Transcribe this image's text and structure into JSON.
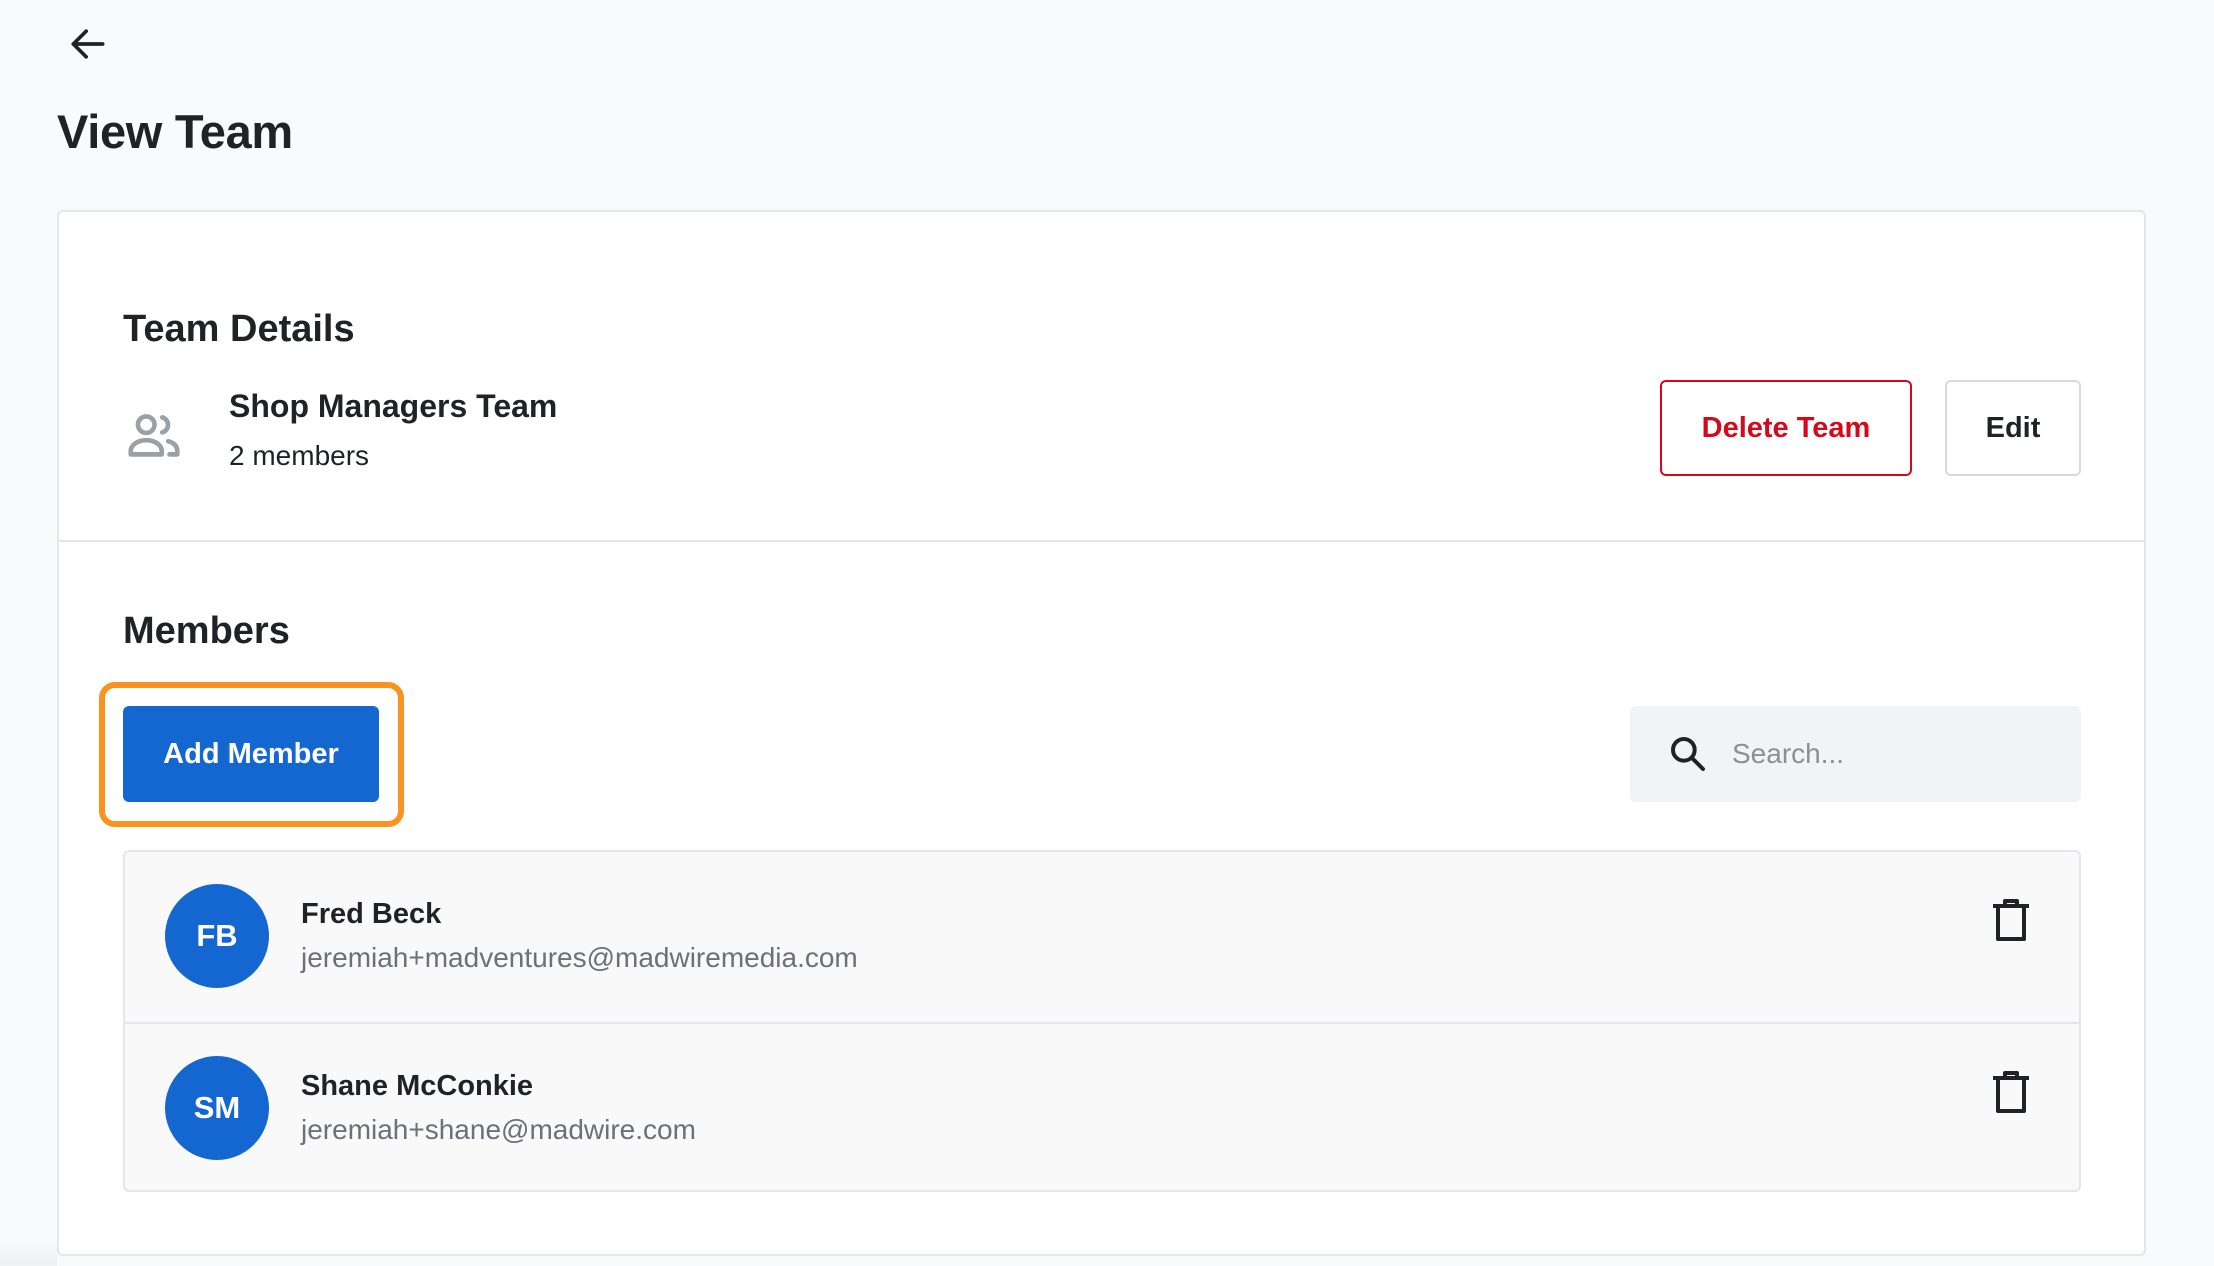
{
  "header": {
    "back_icon": "arrow-left-icon",
    "title": "View Team"
  },
  "team_details": {
    "section_title": "Team Details",
    "icon": "people-icon",
    "team_name": "Shop Managers Team",
    "member_count": "2 members",
    "delete_label": "Delete Team",
    "edit_label": "Edit"
  },
  "members": {
    "section_title": "Members",
    "add_label": "Add Member",
    "search": {
      "icon": "search-icon",
      "placeholder": "Search...",
      "value": ""
    },
    "list": [
      {
        "initials": "FB",
        "name": "Fred Beck",
        "email": "jeremiah+madventures@madwiremedia.com",
        "action_icon": "trash-icon"
      },
      {
        "initials": "SM",
        "name": "Shane McConkie",
        "email": "jeremiah+shane@madwire.com",
        "action_icon": "trash-icon"
      }
    ]
  },
  "colors": {
    "primary": "#1467d0",
    "danger": "#d4091a",
    "highlight": "#f7931e",
    "background": "#f9fafb"
  }
}
